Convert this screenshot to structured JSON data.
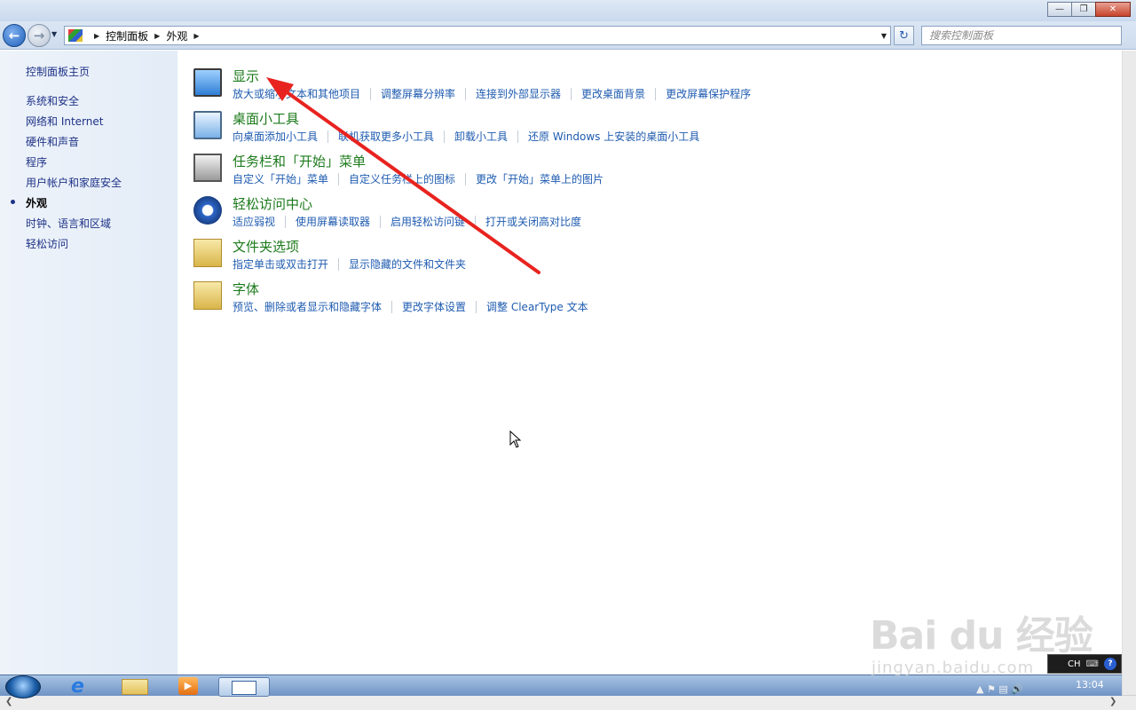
{
  "window": {
    "minimize_icon": "minimize-icon",
    "maximize_icon": "restore-icon",
    "close_icon": "close-icon"
  },
  "nav": {
    "breadcrumb": [
      "控制面板",
      "外观"
    ],
    "search_placeholder": "搜索控制面板"
  },
  "sidebar": {
    "home": "控制面板主页",
    "items": [
      {
        "label": "系统和安全",
        "current": false
      },
      {
        "label": "网络和 Internet",
        "current": false
      },
      {
        "label": "硬件和声音",
        "current": false
      },
      {
        "label": "程序",
        "current": false
      },
      {
        "label": "用户帐户和家庭安全",
        "current": false
      },
      {
        "label": "外观",
        "current": true
      },
      {
        "label": "时钟、语言和区域",
        "current": false
      },
      {
        "label": "轻松访问",
        "current": false
      }
    ]
  },
  "categories": [
    {
      "title": "显示",
      "icon": "display-icon",
      "links": [
        "放大或缩小文本和其他项目",
        "调整屏幕分辨率",
        "连接到外部显示器",
        "更改桌面背景",
        "更改屏幕保护程序"
      ]
    },
    {
      "title": "桌面小工具",
      "icon": "gadgets-icon",
      "links": [
        "向桌面添加小工具",
        "联机获取更多小工具",
        "卸载小工具",
        "还原 Windows 上安装的桌面小工具"
      ]
    },
    {
      "title": "任务栏和「开始」菜单",
      "icon": "taskbar-icon",
      "links": [
        "自定义「开始」菜单",
        "自定义任务栏上的图标",
        "更改「开始」菜单上的图片"
      ]
    },
    {
      "title": "轻松访问中心",
      "icon": "ease-of-access-icon",
      "links": [
        "适应弱视",
        "使用屏幕读取器",
        "启用轻松访问键",
        "打开或关闭高对比度"
      ]
    },
    {
      "title": "文件夹选项",
      "icon": "folder-options-icon",
      "links": [
        "指定单击或双击打开",
        "显示隐藏的文件和文件夹"
      ]
    },
    {
      "title": "字体",
      "icon": "fonts-icon",
      "links": [
        "预览、删除或者显示和隐藏字体",
        "更改字体设置",
        "调整 ClearType 文本"
      ]
    }
  ],
  "taskbar": {
    "clock": "13:04",
    "language": "CH"
  },
  "watermark": {
    "logo": "Bai du 经验",
    "url": "jingyan.baidu.com"
  },
  "colors": {
    "category_title": "#1b7a1b",
    "link": "#1e5bb0",
    "sidebar_bg": "#e8eff8",
    "annotation_arrow": "#e8231f"
  }
}
